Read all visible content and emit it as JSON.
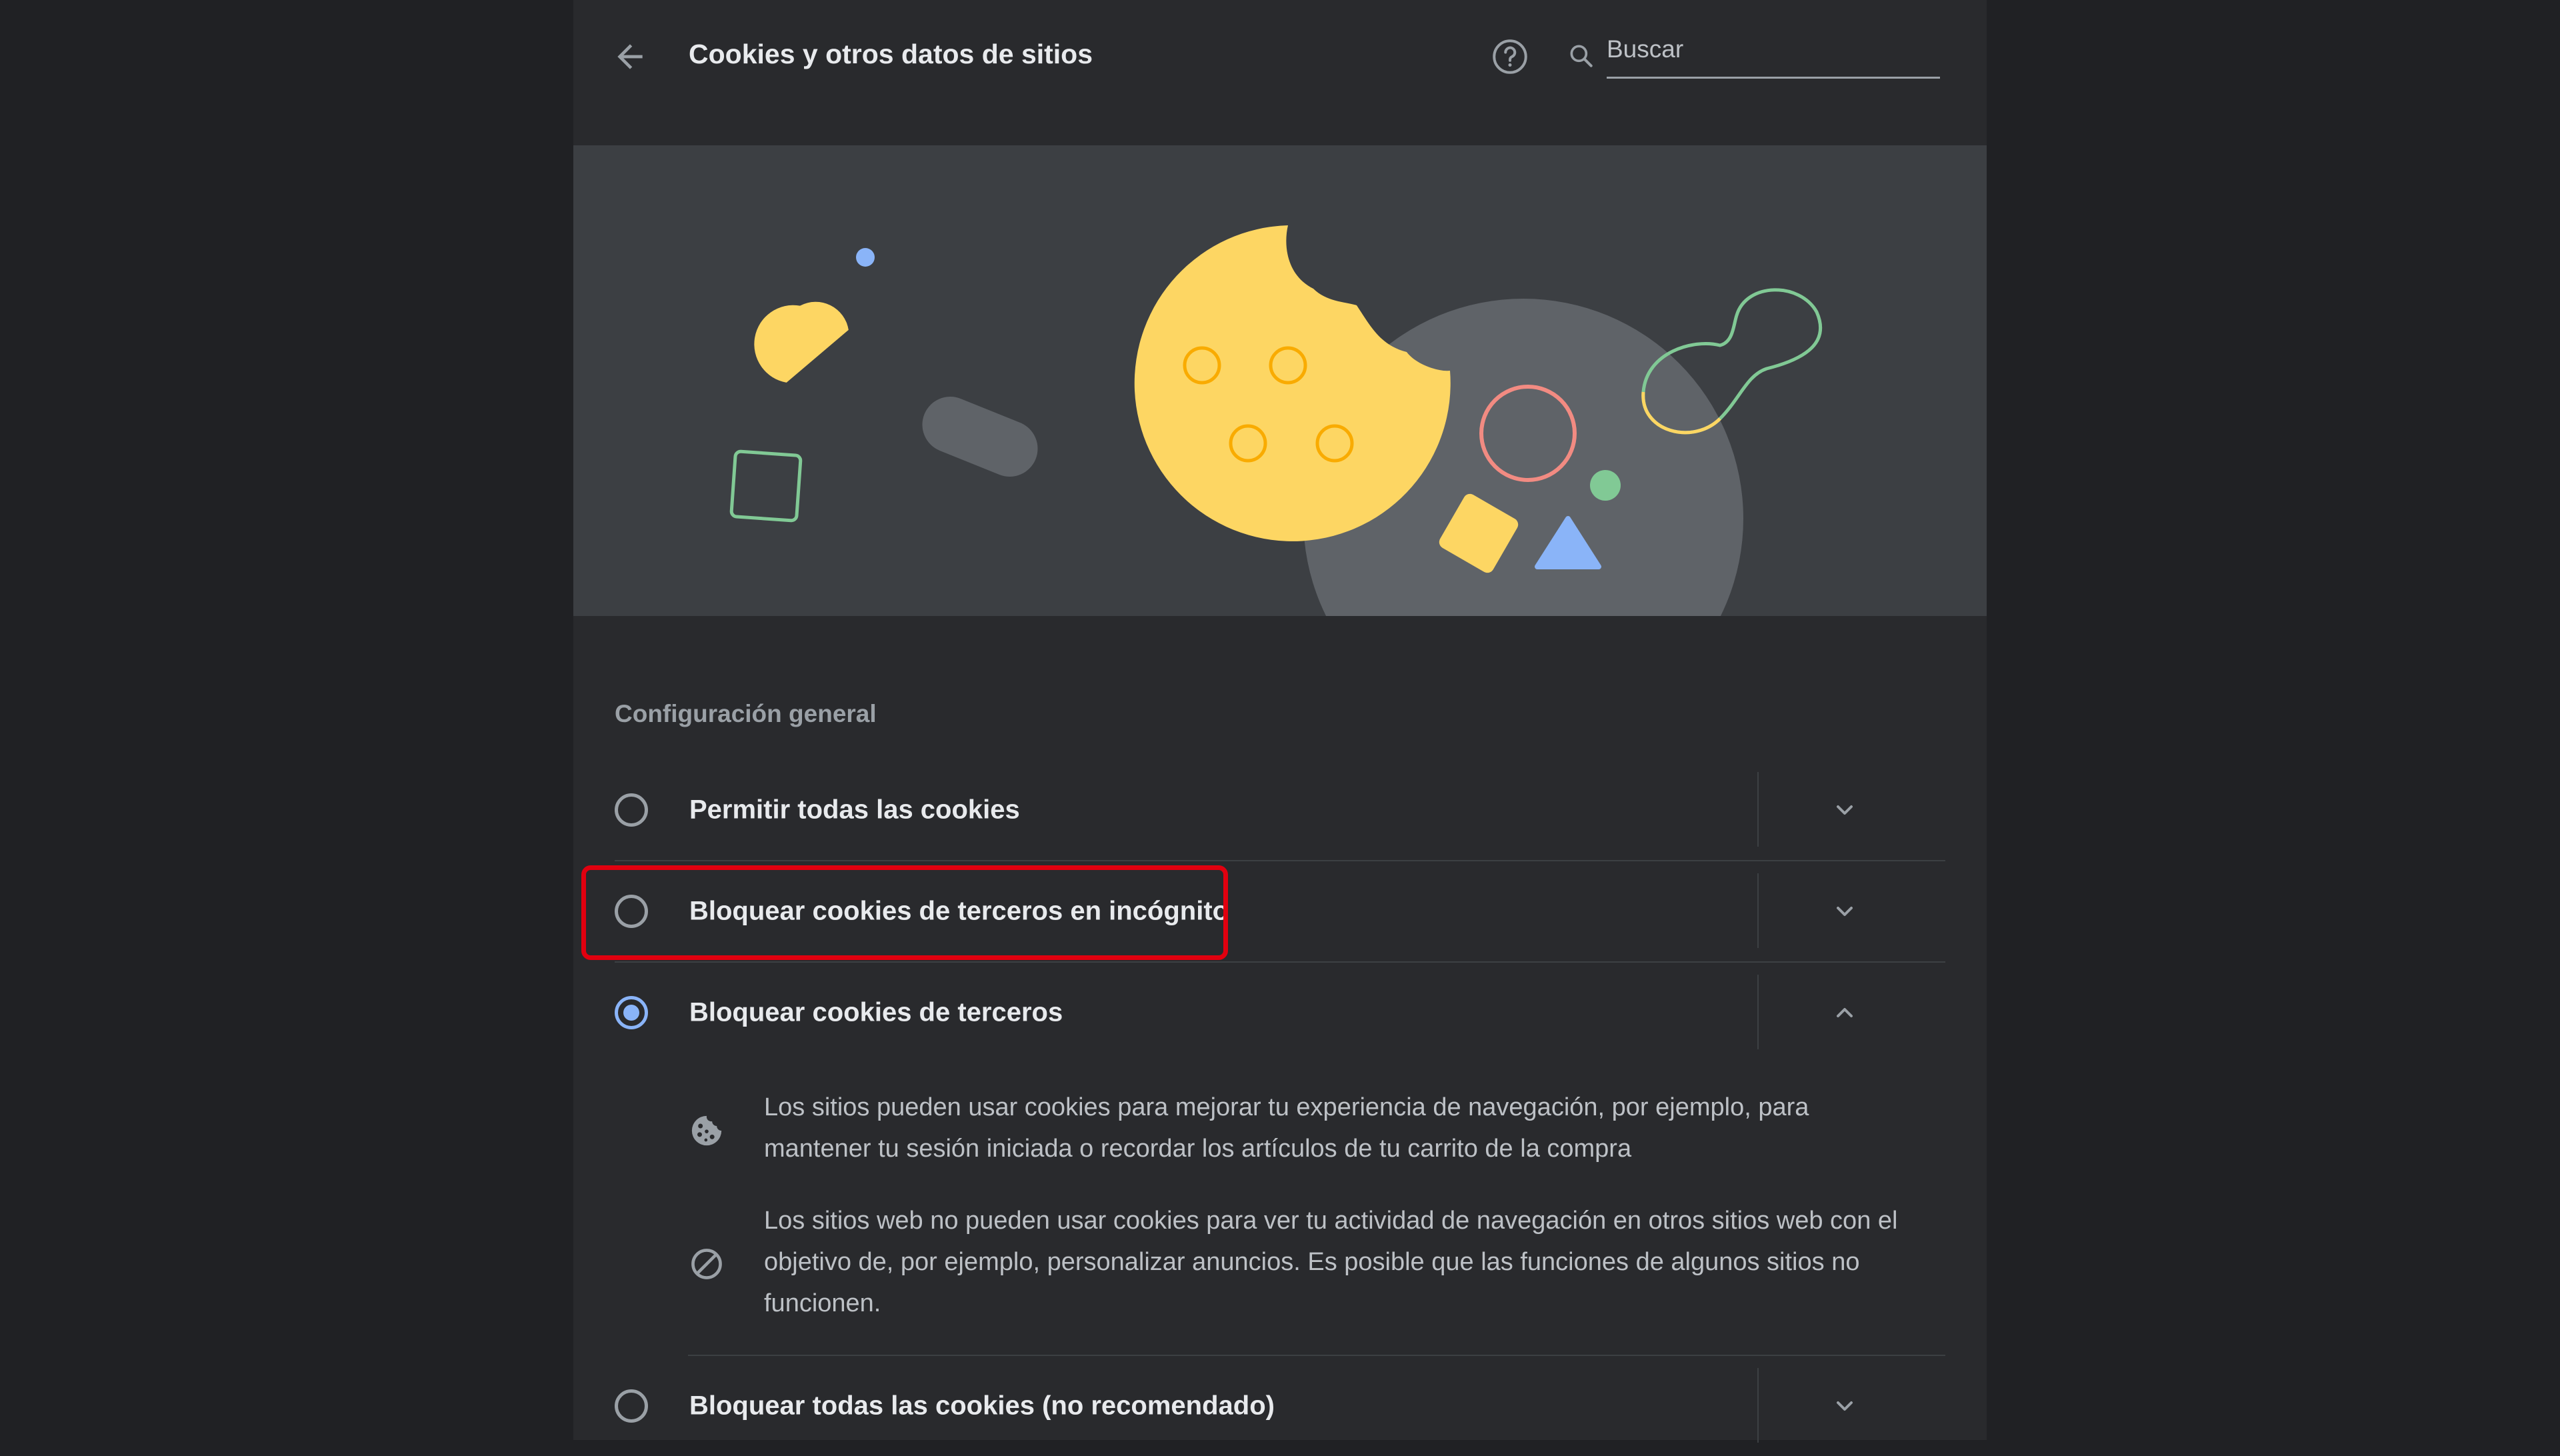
{
  "header": {
    "title": "Cookies y otros datos de sitios",
    "search_placeholder": "Buscar"
  },
  "section_title": "Configuración general",
  "options": [
    {
      "label": "Permitir todas las cookies",
      "selected": false,
      "expanded": false
    },
    {
      "label": "Bloquear cookies de terceros en incógnito",
      "selected": false,
      "expanded": false,
      "highlighted": true
    },
    {
      "label": "Bloquear cookies de terceros",
      "selected": true,
      "expanded": true
    },
    {
      "label": "Bloquear todas las cookies (no recomendado)",
      "selected": false,
      "expanded": false
    }
  ],
  "details": [
    {
      "icon": "cookie-icon",
      "text": "Los sitios pueden usar cookies para mejorar tu experiencia de navegación, por ejemplo, para mantener tu sesión iniciada o recordar los artículos de tu carrito de la compra"
    },
    {
      "icon": "block-icon",
      "text": "Los sitios web no pueden usar cookies para ver tu actividad de navegación en otros sitios web con el objetivo de, por ejemplo, personalizar anuncios. Es posible que las funciones de algunos sitios no funcionen."
    }
  ],
  "colors": {
    "background": "#202124",
    "panel": "#292a2d",
    "banner": "#3c3f43",
    "accent": "#8ab4f8",
    "highlight": "#e1000f",
    "cookie": "#fdd663"
  }
}
